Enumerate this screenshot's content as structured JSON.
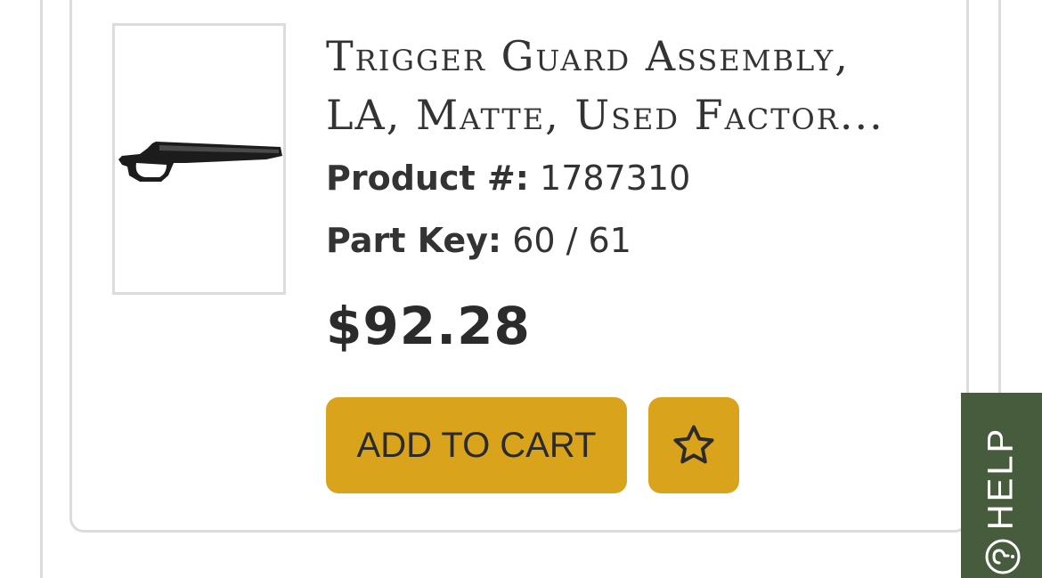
{
  "product": {
    "title_line1": "Trigger Guard Assembly,",
    "title_line2": "LA, Matte, Used Factor...",
    "product_number_label": "Product #:",
    "product_number_value": "1787310",
    "part_key_label": "Part Key:",
    "part_key_value": "60 / 61",
    "price": "$92.28"
  },
  "actions": {
    "add_to_cart_label": "ADD TO CART",
    "wishlist_icon": "star-icon"
  },
  "help": {
    "label": "HELP",
    "icon": "question-circle-icon"
  },
  "colors": {
    "button_gold": "#d9a31b",
    "help_green": "#465c3c",
    "text_dark": "#333333"
  }
}
